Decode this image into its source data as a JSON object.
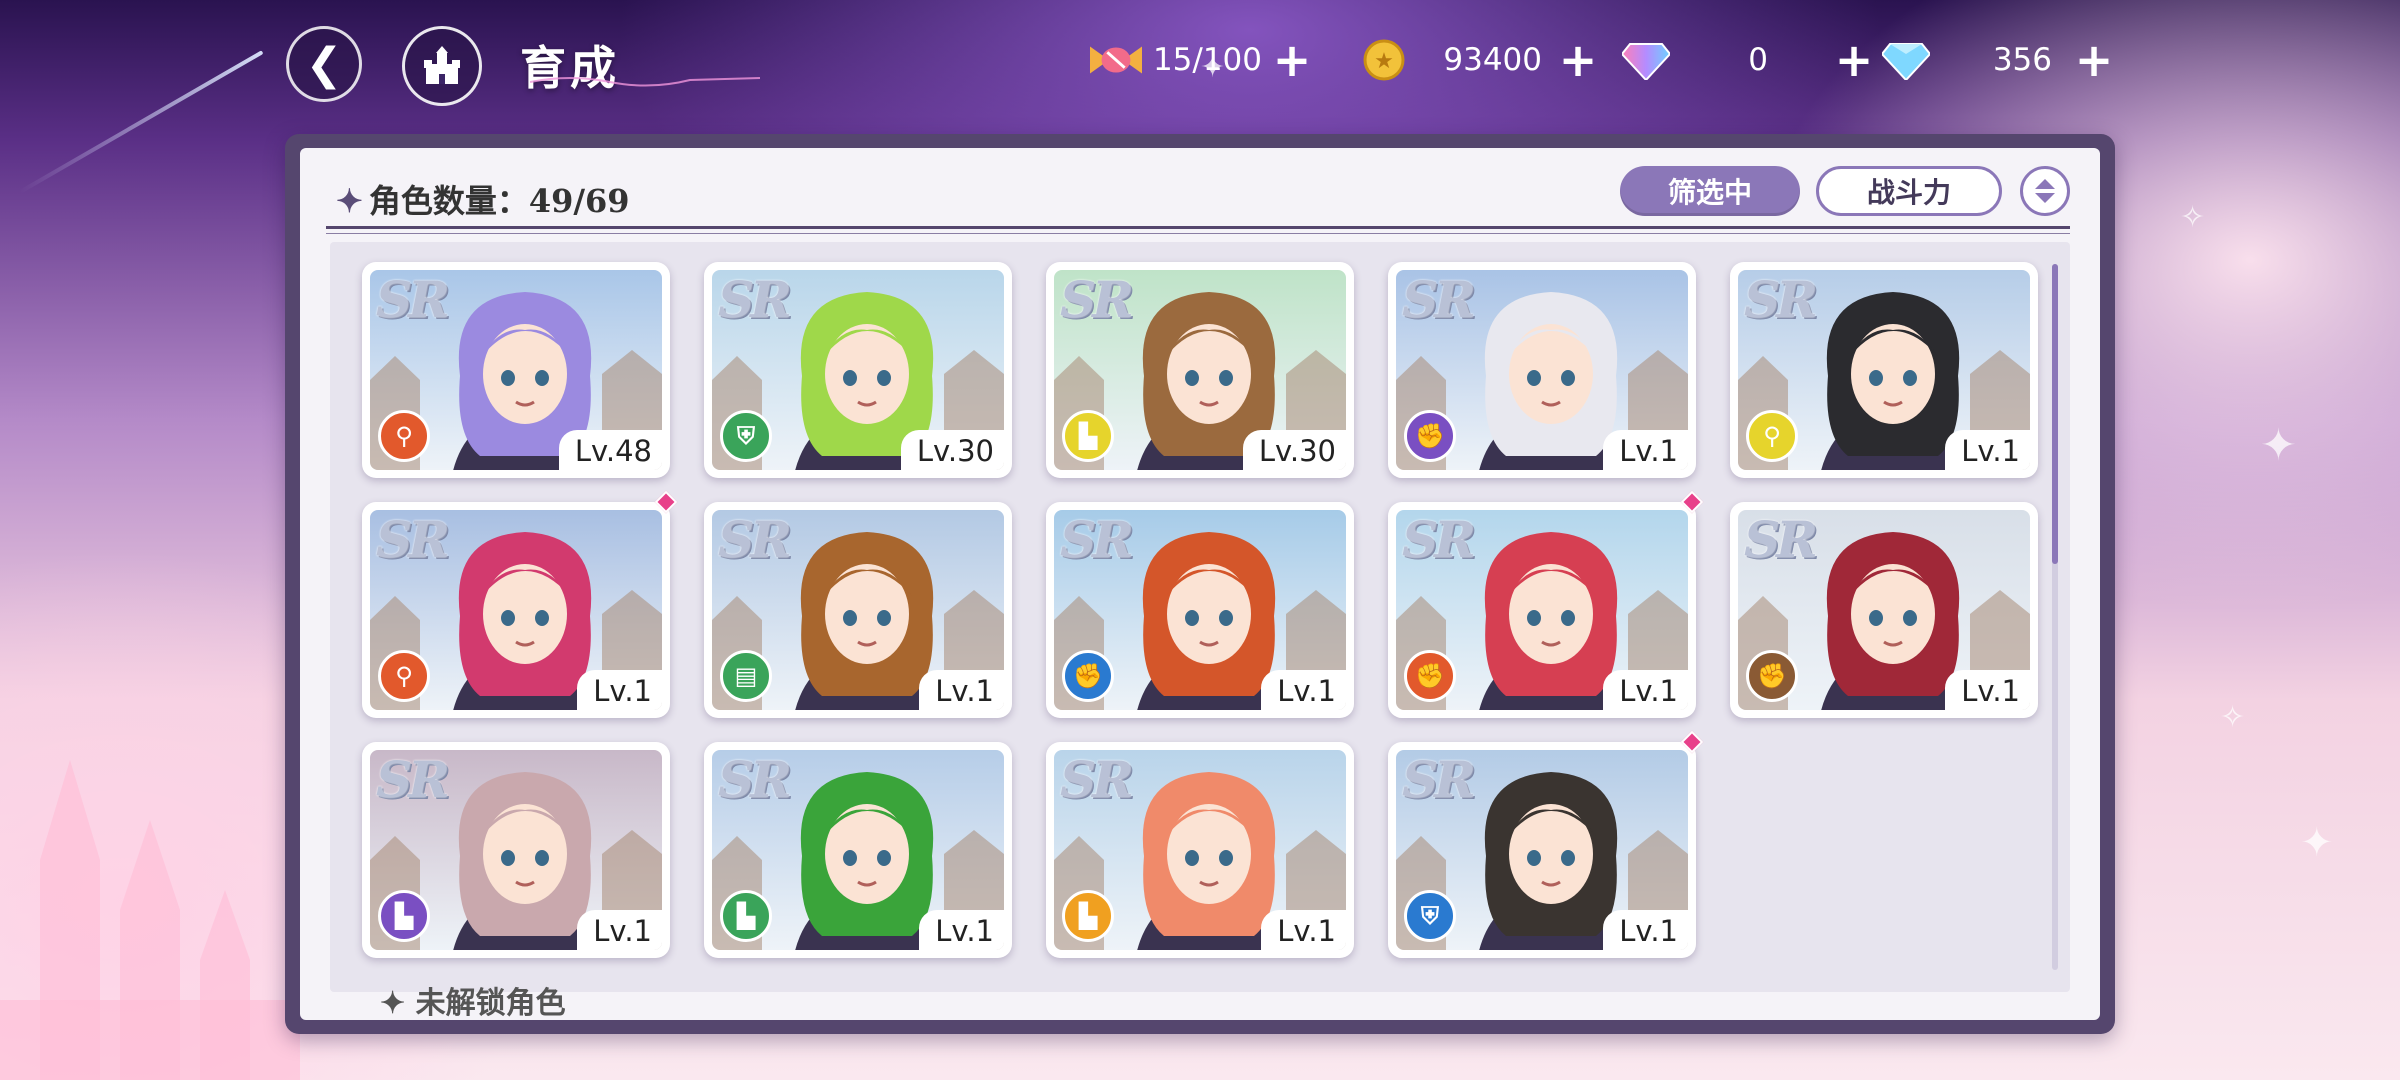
{
  "header": {
    "title": "育成"
  },
  "resources": [
    {
      "name": "candy",
      "value": "15/100",
      "icon": "candy-icon"
    },
    {
      "name": "gold",
      "value": "93400",
      "icon": "gold-coin-icon"
    },
    {
      "name": "rainbow-gem",
      "value": "0",
      "icon": "rainbow-gem-icon"
    },
    {
      "name": "diamond",
      "value": "356",
      "icon": "diamond-icon"
    }
  ],
  "panel": {
    "count_label": "角色数量：49/69",
    "filter_label": "筛选中",
    "sort_label": "战斗力",
    "locked_label": "未解锁角色"
  },
  "rarity_label": "SR",
  "characters": [
    {
      "level": "Lv.48",
      "role_color": "#e2592c",
      "role_icon": "staff-icon",
      "new": false,
      "hair": "#9b8ae0",
      "sky": "#a9c6e8"
    },
    {
      "level": "Lv.30",
      "role_color": "#3aa45a",
      "role_icon": "shield-icon",
      "new": false,
      "hair": "#9fd84a",
      "sky": "#b9d6ea"
    },
    {
      "level": "Lv.30",
      "role_color": "#e6d42c",
      "role_icon": "boot-icon",
      "new": false,
      "hair": "#9b6a3e",
      "sky": "#bfe3c8"
    },
    {
      "level": "Lv.1",
      "role_color": "#7a4fc2",
      "role_icon": "fist-icon",
      "new": false,
      "hair": "#e8e8ef",
      "sky": "#a9c3e6"
    },
    {
      "level": "Lv.1",
      "role_color": "#e6d42c",
      "role_icon": "staff-icon",
      "new": false,
      "hair": "#2b2b2f",
      "sky": "#b6cde8"
    },
    {
      "level": "Lv.1",
      "role_color": "#e2592c",
      "role_icon": "staff-icon",
      "new": true,
      "hair": "#d23a6e",
      "sky": "#a8bfe2"
    },
    {
      "level": "Lv.1",
      "role_color": "#3aa45a",
      "role_icon": "book-icon",
      "new": false,
      "hair": "#a8662e",
      "sky": "#b3c9e4"
    },
    {
      "level": "Lv.1",
      "role_color": "#2a7ad0",
      "role_icon": "fist-icon",
      "new": false,
      "hair": "#d4562a",
      "sky": "#a6cbe8"
    },
    {
      "level": "Lv.1",
      "role_color": "#e2592c",
      "role_icon": "fist-icon",
      "new": true,
      "hair": "#d63f52",
      "sky": "#b3d6ec"
    },
    {
      "level": "Lv.1",
      "role_color": "#8a5a34",
      "role_icon": "fist-icon",
      "new": false,
      "hair": "#a02838",
      "sky": "#d8dfe8"
    },
    {
      "level": "Lv.1",
      "role_color": "#7a4fc2",
      "role_icon": "boot-icon",
      "new": false,
      "hair": "#c9a8ad",
      "sky": "#c8b8c8"
    },
    {
      "level": "Lv.1",
      "role_color": "#3aa45a",
      "role_icon": "boot-icon",
      "new": false,
      "hair": "#3aa43a",
      "sky": "#b6cde8"
    },
    {
      "level": "Lv.1",
      "role_color": "#f0a020",
      "role_icon": "boot-icon",
      "new": false,
      "hair": "#f08a6a",
      "sky": "#b9d4ea"
    },
    {
      "level": "Lv.1",
      "role_color": "#2a7ad0",
      "role_icon": "shield-icon",
      "new": true,
      "hair": "#3a3430",
      "sky": "#b3cbe6"
    }
  ]
}
